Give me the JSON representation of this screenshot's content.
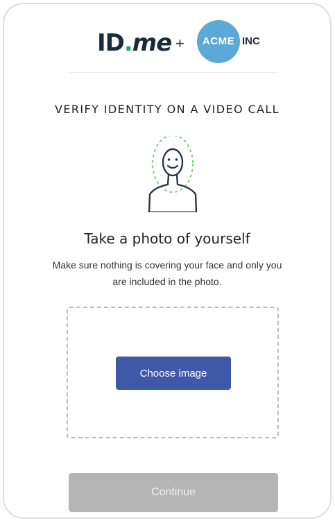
{
  "header": {
    "idme_logo": {
      "id": "ID",
      "dot": ".",
      "me": "me"
    },
    "plus": "+",
    "partner": {
      "badge": "ACME",
      "suffix": "INC"
    }
  },
  "main": {
    "section_title": "VERIFY IDENTITY ON A VIDEO CALL",
    "photo_title": "Take a photo of yourself",
    "photo_description": "Make sure nothing is covering your face and only you are included in the photo.",
    "choose_image_label": "Choose image",
    "continue_label": "Continue"
  },
  "colors": {
    "primary_button": "#3f59a8",
    "disabled_button": "#b5b5b5",
    "acme_badge": "#5ba9d6",
    "idme_dot": "#2e9c6b",
    "face_outline_dashed": "#7ccf7a"
  },
  "icons": {
    "avatar": "face-outline-icon"
  }
}
